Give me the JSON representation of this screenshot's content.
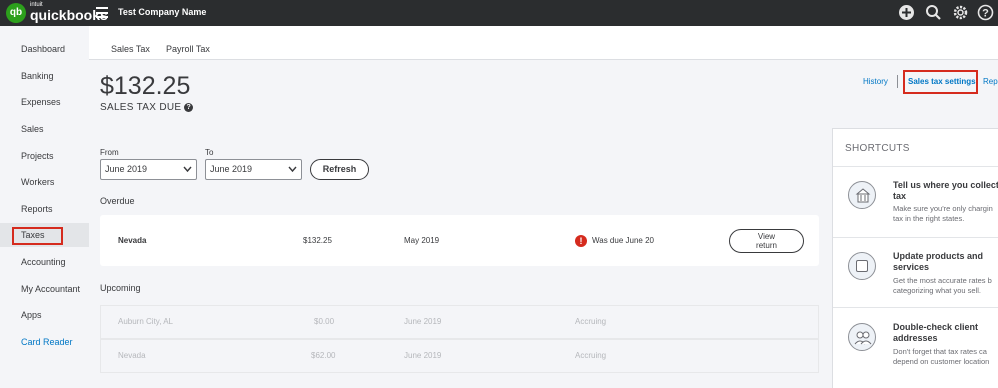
{
  "app": {
    "logo_letters": "qb",
    "brand_small": "intuit",
    "brand": "quickbooks",
    "company_name": "Test Company Name",
    "top_icons": [
      "plus-icon",
      "search-icon",
      "gear-icon",
      "help-icon"
    ]
  },
  "sidebar": {
    "items": [
      {
        "label": "Dashboard"
      },
      {
        "label": "Banking"
      },
      {
        "label": "Expenses"
      },
      {
        "label": "Sales"
      },
      {
        "label": "Projects"
      },
      {
        "label": "Workers"
      },
      {
        "label": "Reports"
      },
      {
        "label": "Taxes",
        "active": true
      },
      {
        "label": "Accounting"
      },
      {
        "label": "My Accountant"
      },
      {
        "label": "Apps"
      },
      {
        "label": "Card Reader"
      }
    ]
  },
  "tabs": [
    {
      "label": "Sales Tax"
    },
    {
      "label": "Payroll Tax"
    }
  ],
  "summary": {
    "amount": "$132.25",
    "label": "SALES TAX DUE",
    "help": "?"
  },
  "links": {
    "history": "History",
    "settings": "Sales tax settings",
    "reports": "Rep"
  },
  "filters": {
    "from_label": "From",
    "from_value": "June 2019",
    "to_label": "To",
    "to_value": "June 2019",
    "refresh": "Refresh"
  },
  "overdue": {
    "label": "Overdue",
    "row": {
      "agency": "Nevada",
      "amount": "$132.25",
      "period": "May 2019",
      "warn": "!",
      "status": "Was due June 20",
      "action_line1": "View",
      "action_line2": "return"
    }
  },
  "upcoming": {
    "label": "Upcoming",
    "rows": [
      {
        "agency": "Auburn City, AL",
        "amount": "$0.00",
        "period": "June 2019",
        "status": "Accruing"
      },
      {
        "agency": "Nevada",
        "amount": "$62.00",
        "period": "June 2019",
        "status": "Accruing"
      }
    ]
  },
  "shortcuts": {
    "title": "SHORTCUTS",
    "items": [
      {
        "icon": "building-icon",
        "title1": "Tell us where you collect",
        "title2": "tax",
        "desc1": "Make sure you're only chargin",
        "desc2": "tax in the right states."
      },
      {
        "icon": "box-icon",
        "title1": "Update products and",
        "title2": "services",
        "desc1": "Get the most accurate rates b",
        "desc2": "categorizing what you sell."
      },
      {
        "icon": "people-icon",
        "title1": "Double-check client",
        "title2": "addresses",
        "desc1": "Don't forget that tax rates ca",
        "desc2": "depend on customer location"
      }
    ]
  }
}
